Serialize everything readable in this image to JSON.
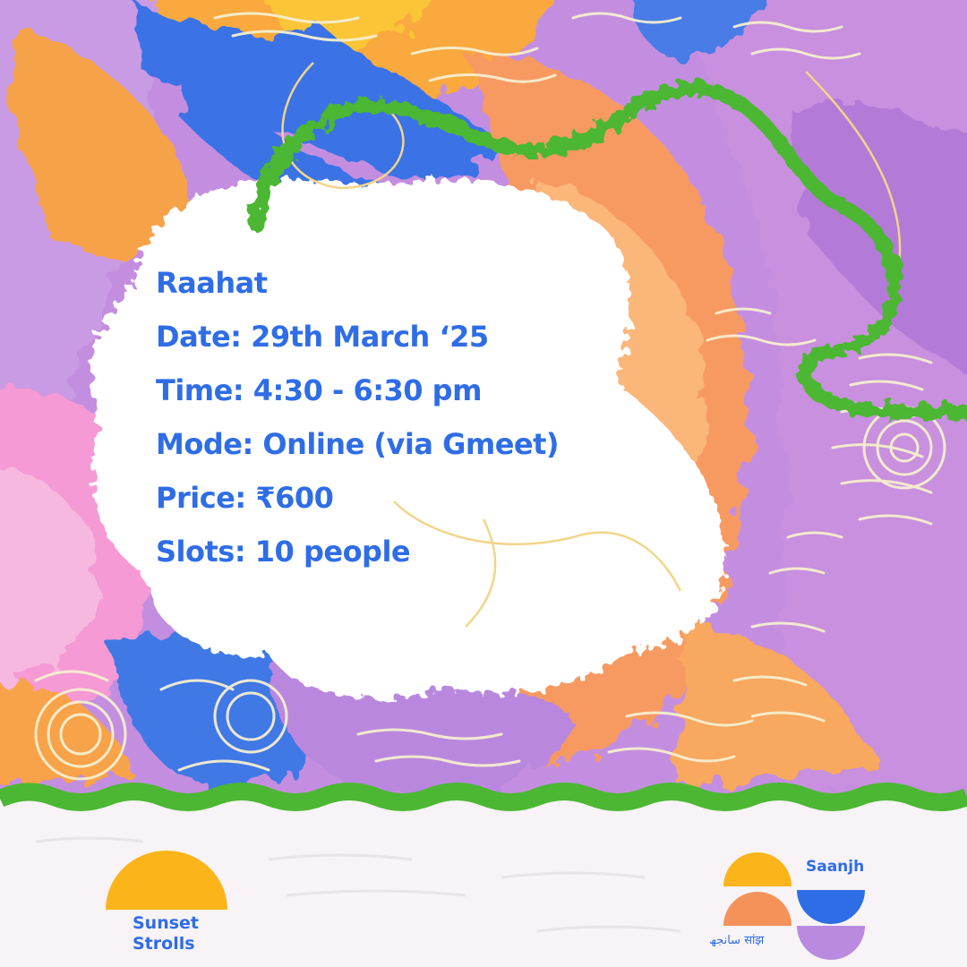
{
  "event": {
    "title": "Raahat",
    "date": "Date: 29th March ‘25",
    "time": "Time: 4:30 - 6:30 pm",
    "mode": "Mode: Online (via Gmeet)",
    "price": "Price: ₹600",
    "slots": "Slots: 10 people"
  },
  "logos": {
    "sunset_strolls": {
      "line1": "Sunset",
      "line2": "Strolls",
      "sun_color": "#fbb41a"
    },
    "saanjh": {
      "name": "Saanjh",
      "script_text": "سانجھ  सांझ",
      "colors": [
        "#fbb41a",
        "#f4925a",
        "#2f6de6",
        "#b98ae0"
      ]
    }
  },
  "colors": {
    "text": "#2f6de6",
    "accent_green": "#4cb733",
    "background_cream": "#f6f2f6"
  }
}
